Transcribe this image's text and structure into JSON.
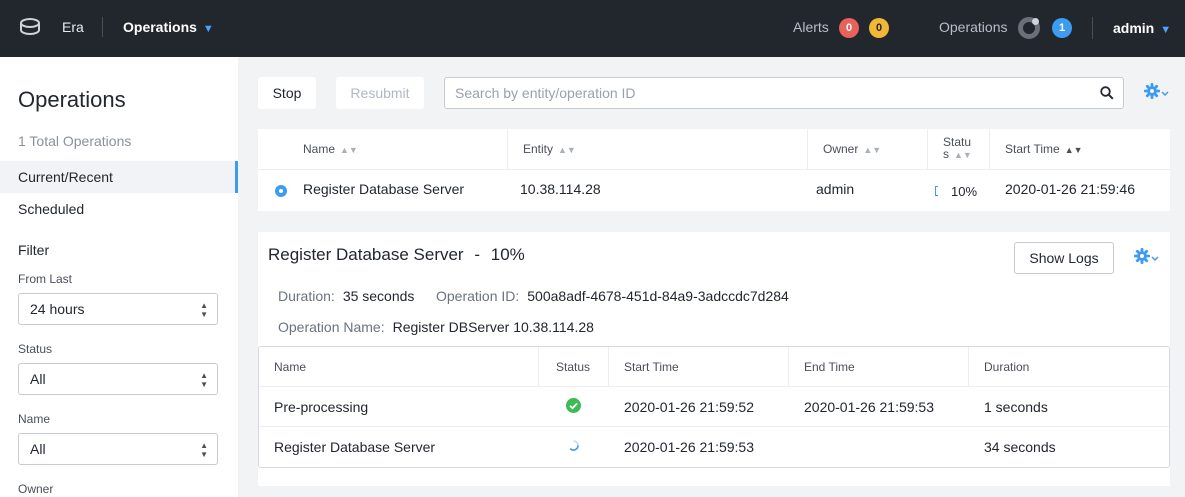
{
  "topbar": {
    "app_name": "Era",
    "nav_menu": "Operations",
    "alerts_label": "Alerts",
    "alerts_critical": "0",
    "alerts_warning": "0",
    "operations_label": "Operations",
    "operations_count": "1",
    "user": "admin"
  },
  "sidebar": {
    "title": "Operations",
    "total": "1 Total Operations",
    "items": [
      {
        "label": "Current/Recent",
        "active": true
      },
      {
        "label": "Scheduled",
        "active": false
      }
    ],
    "filter_title": "Filter",
    "filters": [
      {
        "label": "From Last",
        "value": "24 hours"
      },
      {
        "label": "Status",
        "value": "All"
      },
      {
        "label": "Name",
        "value": "All"
      },
      {
        "label": "Owner",
        "value": ""
      }
    ]
  },
  "toolbar": {
    "stop_label": "Stop",
    "resubmit_label": "Resubmit",
    "search_placeholder": "Search by entity/operation ID"
  },
  "operations_table": {
    "columns": [
      "Name",
      "Entity",
      "Owner",
      "Status",
      "Start Time"
    ],
    "status_header_line1": "Statu",
    "status_header_line2": "s",
    "rows": [
      {
        "name": "Register Database Server",
        "entity": "10.38.114.28",
        "owner": "admin",
        "status": "10%",
        "progress": 0.1,
        "start_time": "2020-01-26 21:59:46"
      }
    ]
  },
  "detail": {
    "title": "Register Database Server",
    "separator": "-",
    "percent": "10%",
    "show_logs_label": "Show Logs",
    "duration_label": "Duration:",
    "duration_value": "35 seconds",
    "operation_id_label": "Operation ID:",
    "operation_id_value": "500a8adf-4678-451d-84a9-3adccdc7d284",
    "operation_name_label": "Operation Name:",
    "operation_name_value": "Register DBServer 10.38.114.28",
    "steps": {
      "columns": [
        "Name",
        "Status",
        "Start Time",
        "End Time",
        "Duration"
      ],
      "rows": [
        {
          "name": "Pre-processing",
          "status": "success-icon",
          "start_time": "2020-01-26 21:59:52",
          "end_time": "2020-01-26 21:59:53",
          "duration": "1 seconds"
        },
        {
          "name": "Register Database Server",
          "status": "spinner-icon",
          "start_time": "2020-01-26 21:59:53",
          "end_time": "",
          "duration": "34 seconds"
        }
      ]
    }
  },
  "colors": {
    "topbar_bg": "#22272e",
    "accent_blue": "#3d9cf0",
    "alert_red": "#e8615a",
    "alert_yellow": "#f0b833",
    "success_green": "#3cba54"
  }
}
